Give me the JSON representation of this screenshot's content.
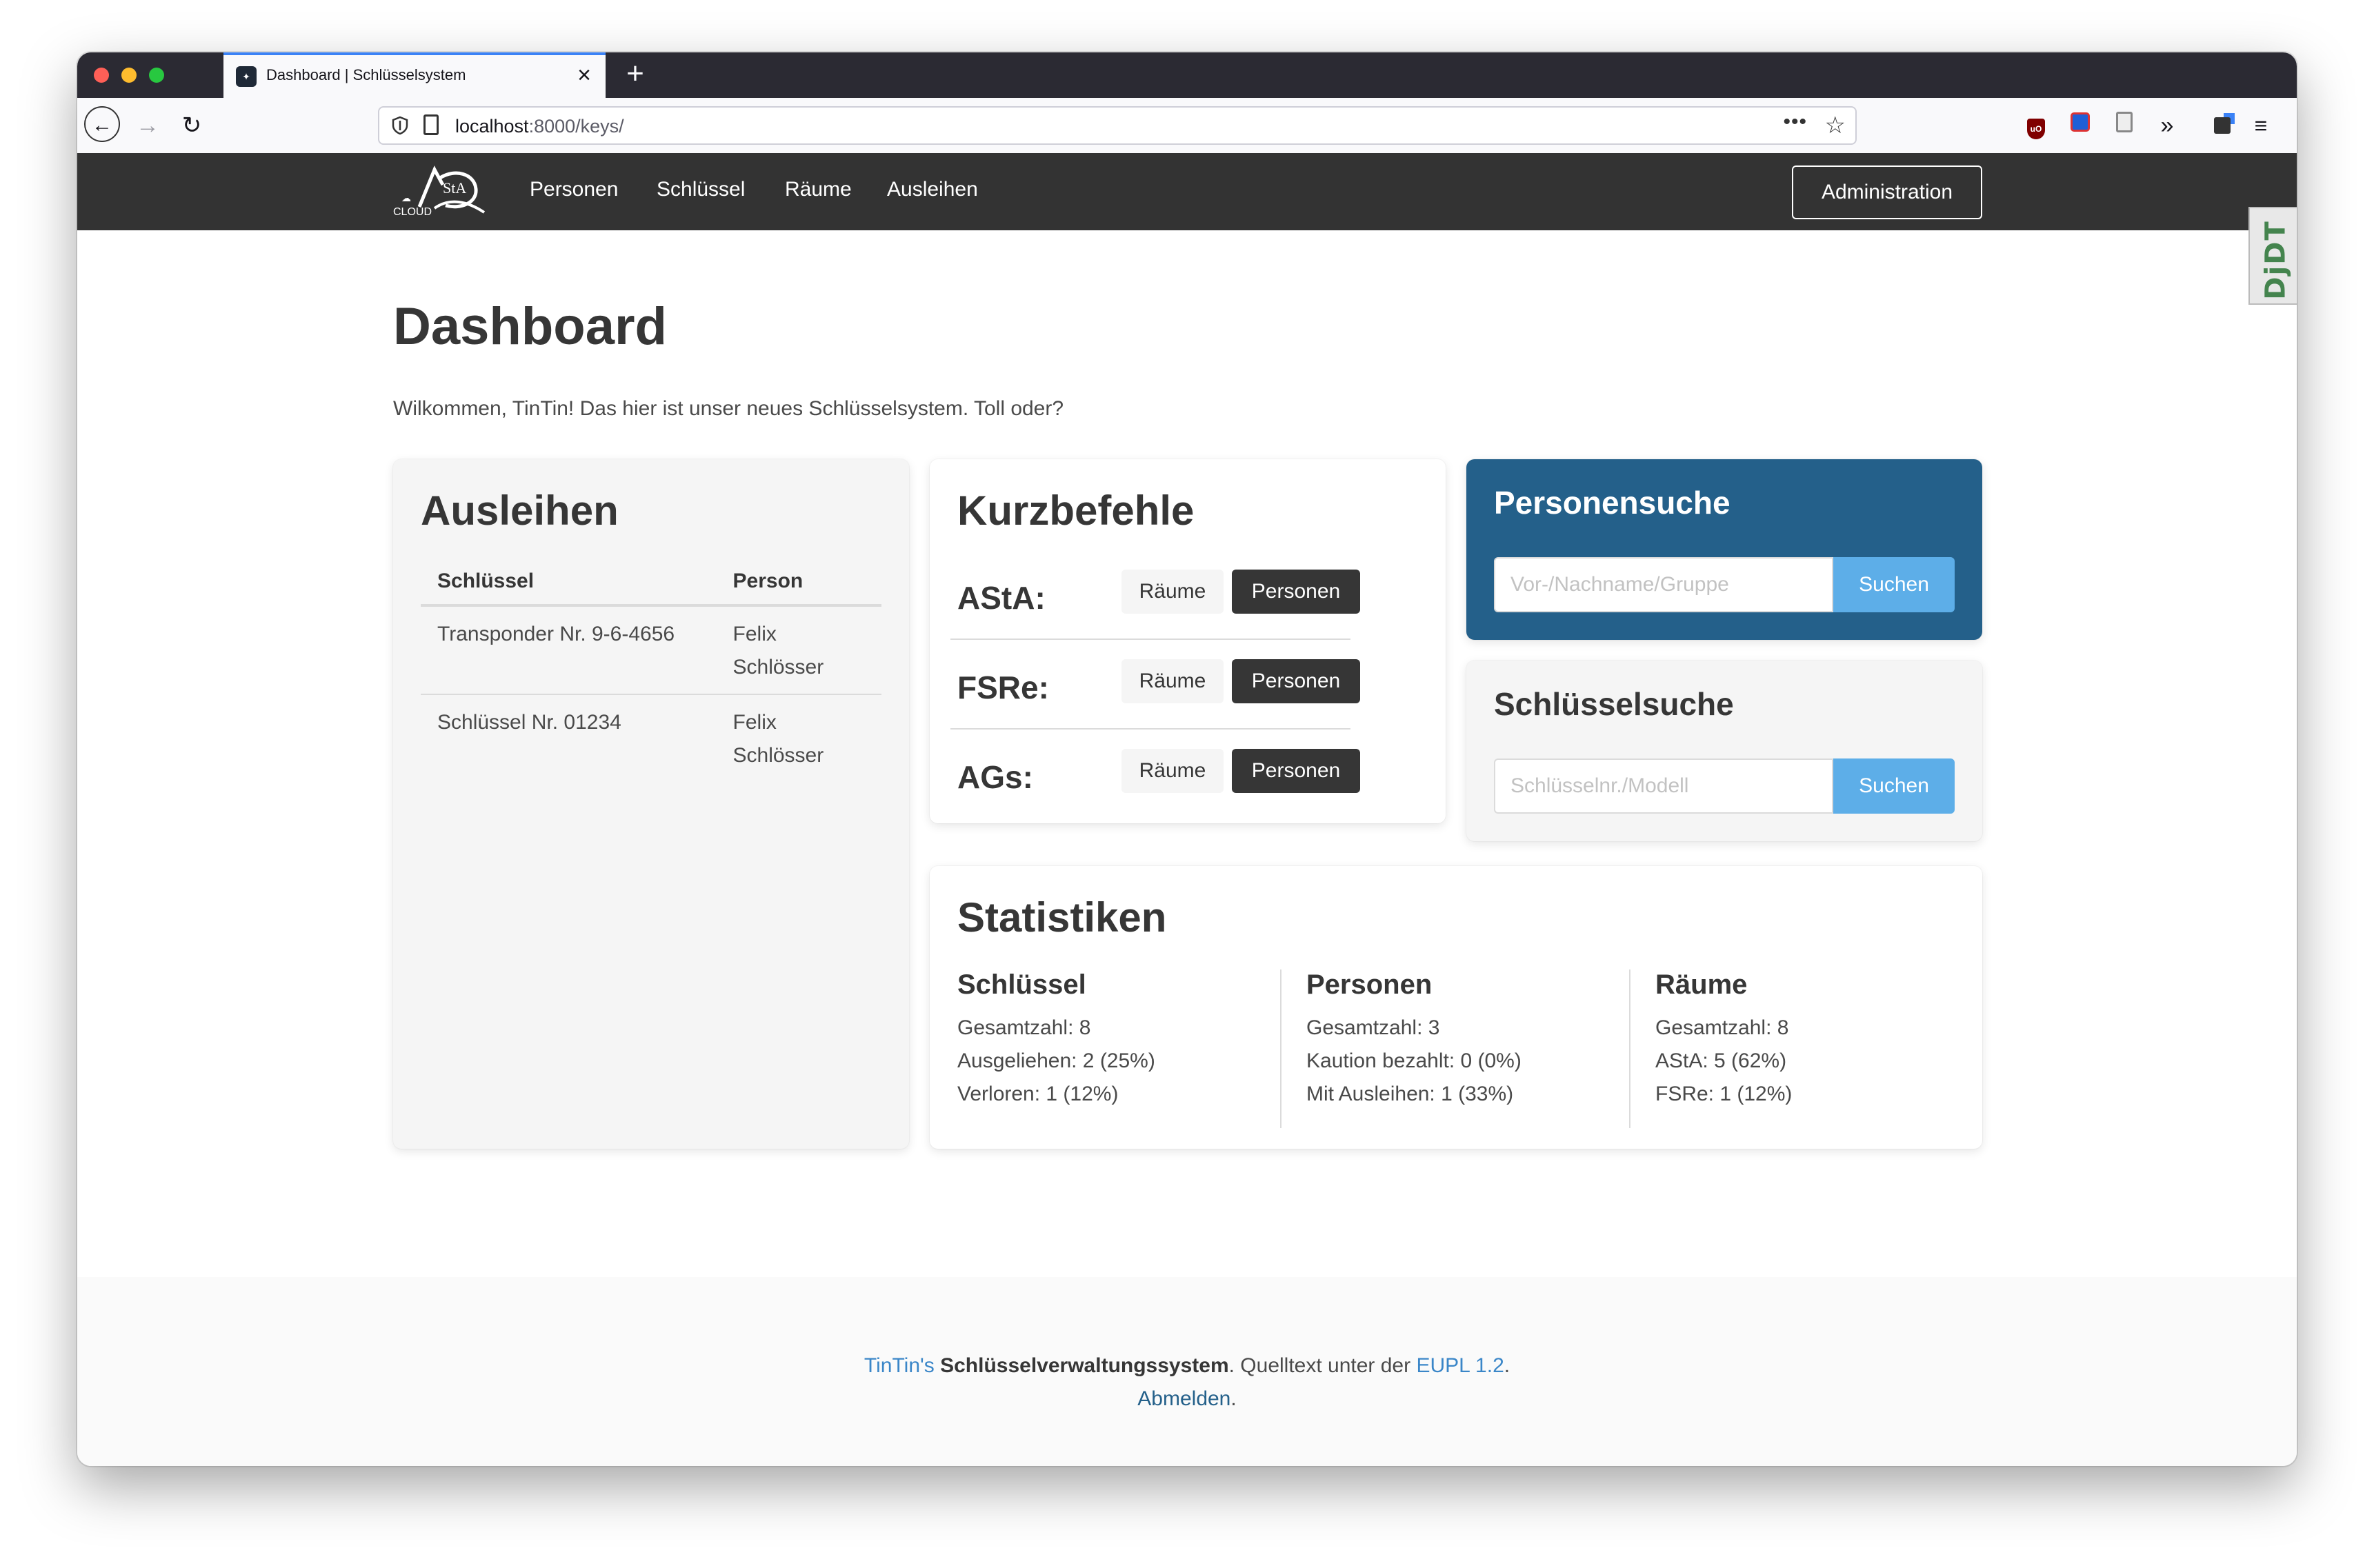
{
  "browser": {
    "tab_title": "Dashboard | Schlüsselsystem",
    "url_host": "localhost",
    "url_path": ":8000/keys/"
  },
  "site_nav": {
    "logo_text": "AStA",
    "logo_subtext": "CLOUD",
    "links": [
      "Personen",
      "Schlüssel",
      "Räume",
      "Ausleihen"
    ],
    "admin_label": "Administration"
  },
  "djdt_label": "DjDT",
  "page": {
    "title": "Dashboard",
    "welcome": "Wilkommen, TinTin! Das hier ist unser neues Schlüsselsystem. Toll oder?"
  },
  "ausleihen": {
    "title": "Ausleihen",
    "columns": [
      "Schlüssel",
      "Person"
    ],
    "rows": [
      {
        "key": "Transponder Nr. 9-6-4656",
        "person": "Felix Schlösser"
      },
      {
        "key": "Schlüssel Nr. 01234",
        "person": "Felix Schlösser"
      }
    ]
  },
  "kurzbefehle": {
    "title": "Kurzbefehle",
    "rows": [
      {
        "label": "AStA:",
        "rooms": "Räume",
        "persons": "Personen"
      },
      {
        "label": "FSRe:",
        "rooms": "Räume",
        "persons": "Personen"
      },
      {
        "label": "AGs:",
        "rooms": "Räume",
        "persons": "Personen"
      }
    ]
  },
  "personensuche": {
    "title": "Personensuche",
    "placeholder": "Vor-/Nachname/Gruppe",
    "button": "Suchen"
  },
  "schluesselsuche": {
    "title": "Schlüsselsuche",
    "placeholder": "Schlüsselnr./Modell",
    "button": "Suchen"
  },
  "statistiken": {
    "title": "Statistiken",
    "columns": [
      {
        "head": "Schlüssel",
        "lines": [
          "Gesamtzahl: 8",
          "Ausgeliehen: 2 (25%)",
          "Verloren: 1 (12%)"
        ]
      },
      {
        "head": "Personen",
        "lines": [
          "Gesamtzahl: 3",
          "Kaution bezahlt: 0 (0%)",
          "Mit Ausleihen: 1 (33%)"
        ]
      },
      {
        "head": "Räume",
        "lines": [
          "Gesamtzahl: 8",
          "AStA: 5 (62%)",
          "FSRe: 1 (12%)"
        ]
      }
    ]
  },
  "footer": {
    "author": "TinTin's",
    "system": "Schlüsselverwaltungssystem",
    "text_mid": ". Quelltext unter der ",
    "license": "EUPL 1.2",
    "text_end": ".",
    "logout": "Abmelden",
    "logout_end": "."
  },
  "colors": {
    "navbar": "#333333",
    "personensuche_bg": "#24608a",
    "search_button": "#5daee8",
    "link": "#3a86c8"
  }
}
